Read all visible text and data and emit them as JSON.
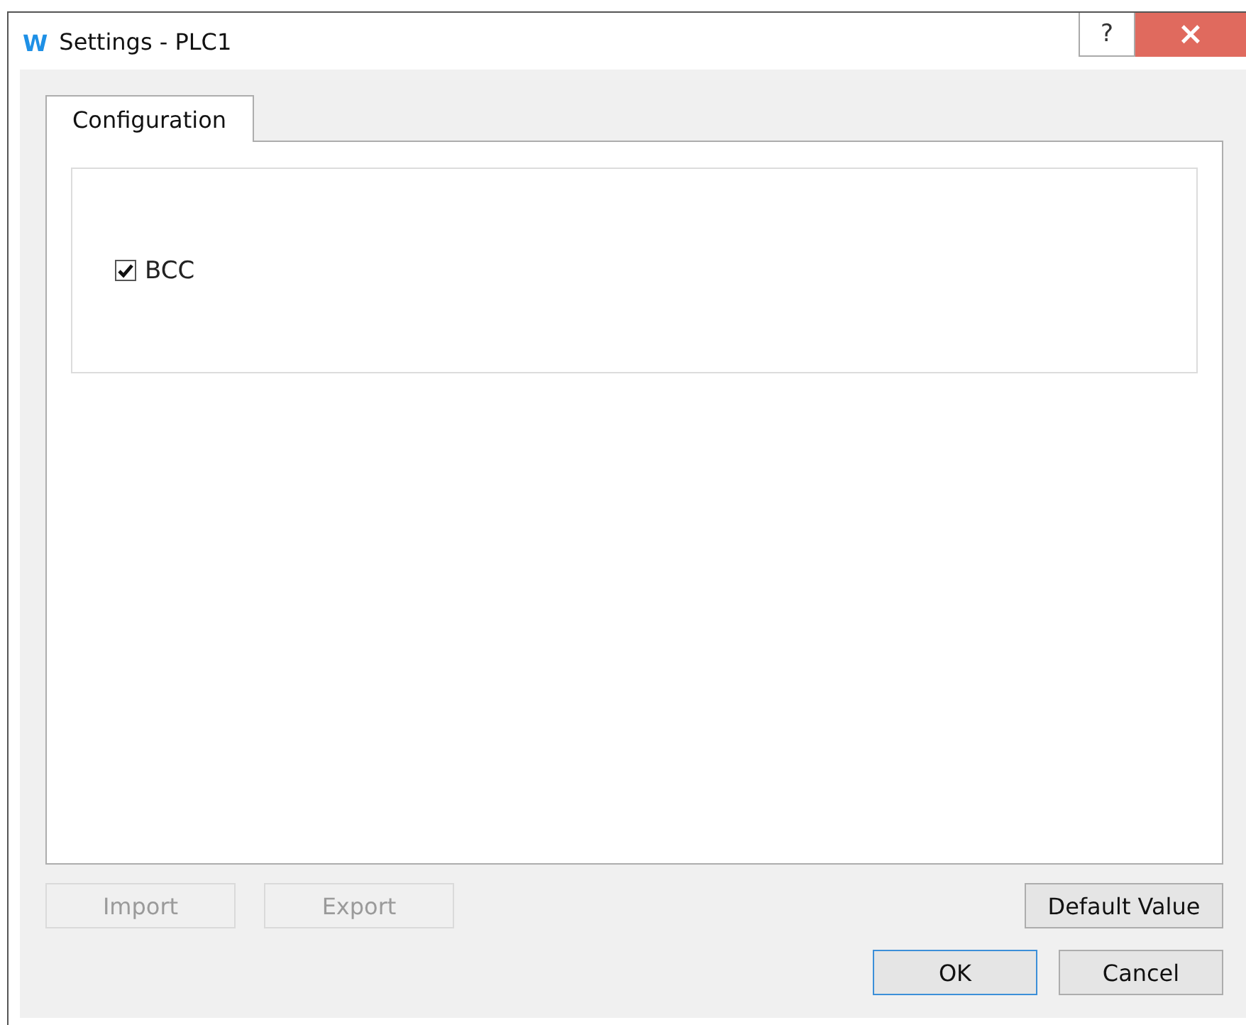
{
  "window": {
    "logo": "W",
    "title": "Settings - PLC1",
    "help": "?",
    "close": "×"
  },
  "tabs": [
    {
      "label": "Configuration",
      "selected": true
    }
  ],
  "options": [
    {
      "label": "BCC",
      "checked": true
    }
  ],
  "buttons": [
    {
      "label": "Import",
      "disabled": true
    },
    {
      "label": "Export",
      "disabled": true
    },
    {
      "label": "Default Value",
      "disabled": false
    }
  ],
  "dialog_buttons": [
    {
      "label": "OK",
      "default": true
    },
    {
      "label": "Cancel",
      "default": false
    }
  ]
}
